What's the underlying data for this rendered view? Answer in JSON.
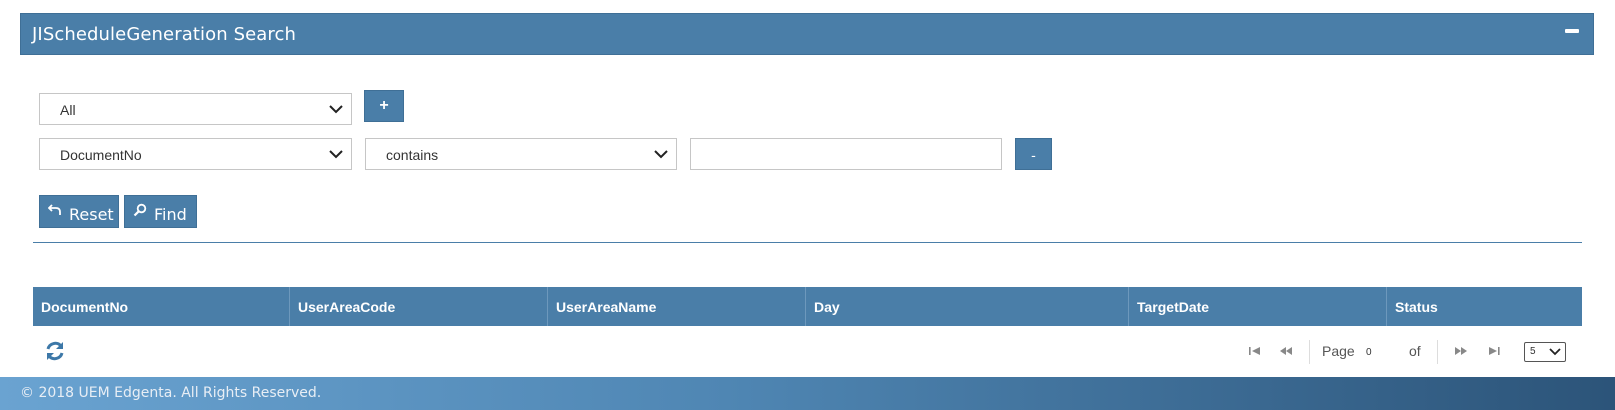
{
  "panel": {
    "title": "JIScheduleGeneration Search",
    "collapse_icon": "minus-icon"
  },
  "filter": {
    "scope_select": "All",
    "add_label": "+",
    "field_select": "DocumentNo",
    "operator_select": "contains",
    "value_input": "",
    "remove_label": "-"
  },
  "actions": {
    "reset_label": "Reset",
    "reset_icon": "undo-arrow-icon",
    "find_label": "Find",
    "find_icon": "search-icon"
  },
  "grid": {
    "columns": [
      "DocumentNo",
      "UserAreaCode",
      "UserAreaName",
      "Day",
      "TargetDate",
      "Status"
    ]
  },
  "pager": {
    "page_label": "Page",
    "page_value": "0",
    "of_label": "of",
    "page_size": "5"
  },
  "footer": {
    "text": "© 2018 UEM Edgenta. All Rights Reserved."
  },
  "colors": {
    "primary": "#4a7ea8",
    "header_text": "#ffffff"
  }
}
